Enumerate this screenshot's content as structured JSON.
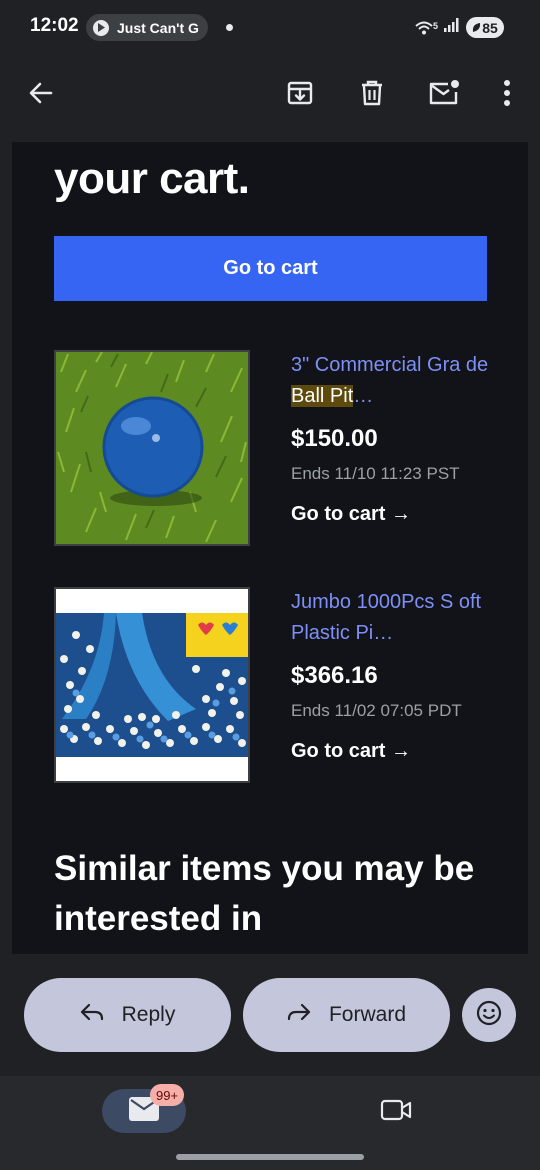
{
  "status_bar": {
    "time": "12:02",
    "media_label": "Just Can't G",
    "battery": "85",
    "wifi_badge": "5"
  },
  "toolbar": {
    "back_icon": "arrow-left-icon",
    "archive_icon": "archive-icon",
    "delete_icon": "trash-icon",
    "mark_unread_icon": "mail-unread-icon",
    "more_icon": "more-vertical-icon"
  },
  "email": {
    "headline": "your cart.",
    "cart_button": "Go to cart",
    "items": [
      {
        "title_before": "3\" Commercial Gra de ",
        "title_highlight": "Ball Pit",
        "title_after": "…",
        "price": "$150.00",
        "ends": "Ends 11/10 11:23 PST",
        "link": "Go to cart →"
      },
      {
        "title_before": "Jumbo 1000Pcs S oft Plastic Pi…",
        "title_highlight": "",
        "title_after": "",
        "price": "$366.16",
        "ends": "Ends 11/02 07:05 PDT",
        "link": "Go to cart →"
      }
    ],
    "similar_heading": "Similar items you may be interested in"
  },
  "actions": {
    "reply": "Reply",
    "forward": "Forward"
  },
  "bottom_nav": {
    "mail_badge": "99+"
  },
  "colors": {
    "accent_button": "#3665f3",
    "link": "#7e8ff5",
    "highlight": "#5e4a0c",
    "pill": "#c4c7dc"
  }
}
